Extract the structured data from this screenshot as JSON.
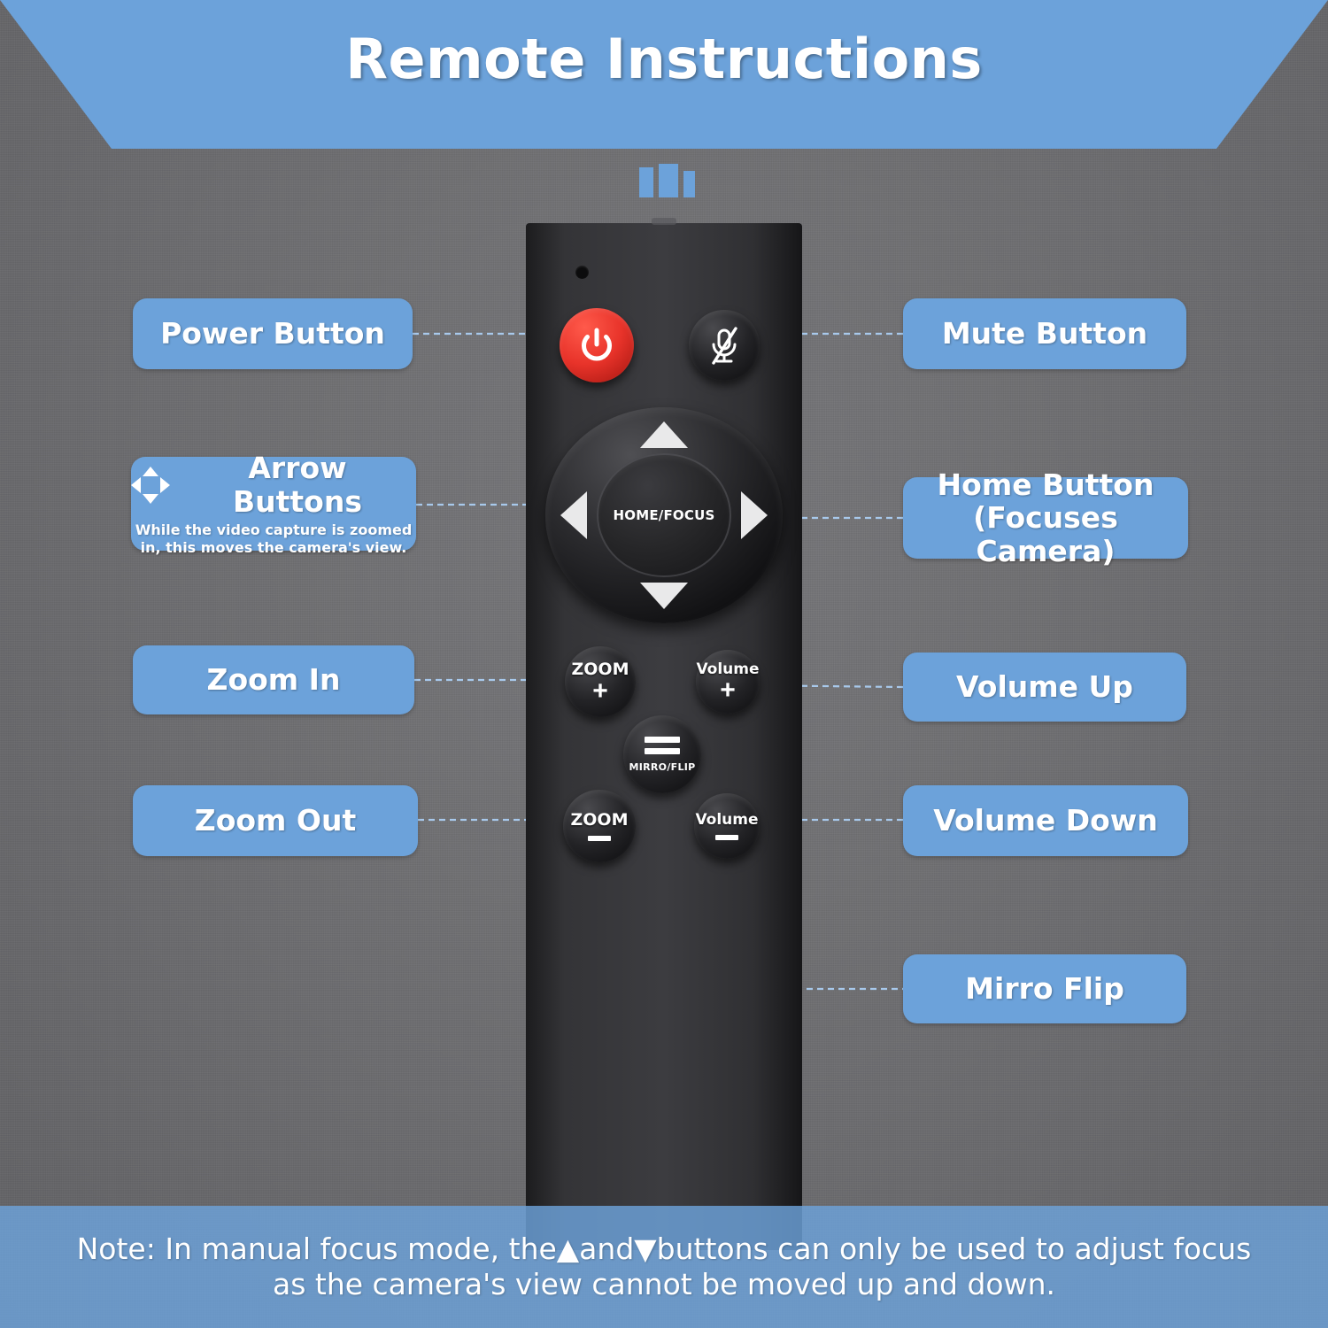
{
  "header": {
    "title": "Remote Instructions",
    "accent_color": "#6ca2da",
    "bars_icon": "three-bars-icon"
  },
  "remote": {
    "ir_led": "ir-led-indicator",
    "buttons": {
      "power": {
        "icon": "power-icon",
        "color": "#e8332a"
      },
      "mute": {
        "icon": "microphone-muted-icon",
        "color": "#232326"
      },
      "dpad": {
        "center_label": "HOME/FOCUS",
        "up": "arrow-up-icon",
        "down": "arrow-down-icon",
        "left": "arrow-left-icon",
        "right": "arrow-right-icon"
      },
      "zoom_in": {
        "caption": "ZOOM",
        "sign": "+"
      },
      "zoom_out": {
        "caption": "ZOOM",
        "sign": "–"
      },
      "volume_up": {
        "caption": "Volume",
        "sign": "+"
      },
      "volume_down": {
        "caption": "Volume",
        "sign": "–"
      },
      "mirror_flip": {
        "caption": "MIRRO/FLIP",
        "icon": "two-bars-flip-icon"
      }
    }
  },
  "labels": {
    "power": {
      "title": "Power Button"
    },
    "arrows": {
      "title": "Arrow Buttons",
      "icon": "four-direction-arrow-icon",
      "description": "While the video capture is zoomed in, this moves the camera's view."
    },
    "zoom_in": {
      "title": "Zoom In"
    },
    "zoom_out": {
      "title": "Zoom Out"
    },
    "mute": {
      "title": "Mute Button"
    },
    "home": {
      "title": "Home Button\n(Focuses Camera)",
      "line1": "Home Button",
      "line2": "(Focuses Camera)"
    },
    "volume_up": {
      "title": "Volume Up"
    },
    "volume_down": {
      "title": "Volume Down"
    },
    "mirror_flip": {
      "title": "Mirro Flip"
    }
  },
  "note": {
    "line1": "Note: In manual focus mode, the▲and▼buttons can only be used to adjust focus",
    "line2": "as the camera's view cannot be moved up and down."
  }
}
